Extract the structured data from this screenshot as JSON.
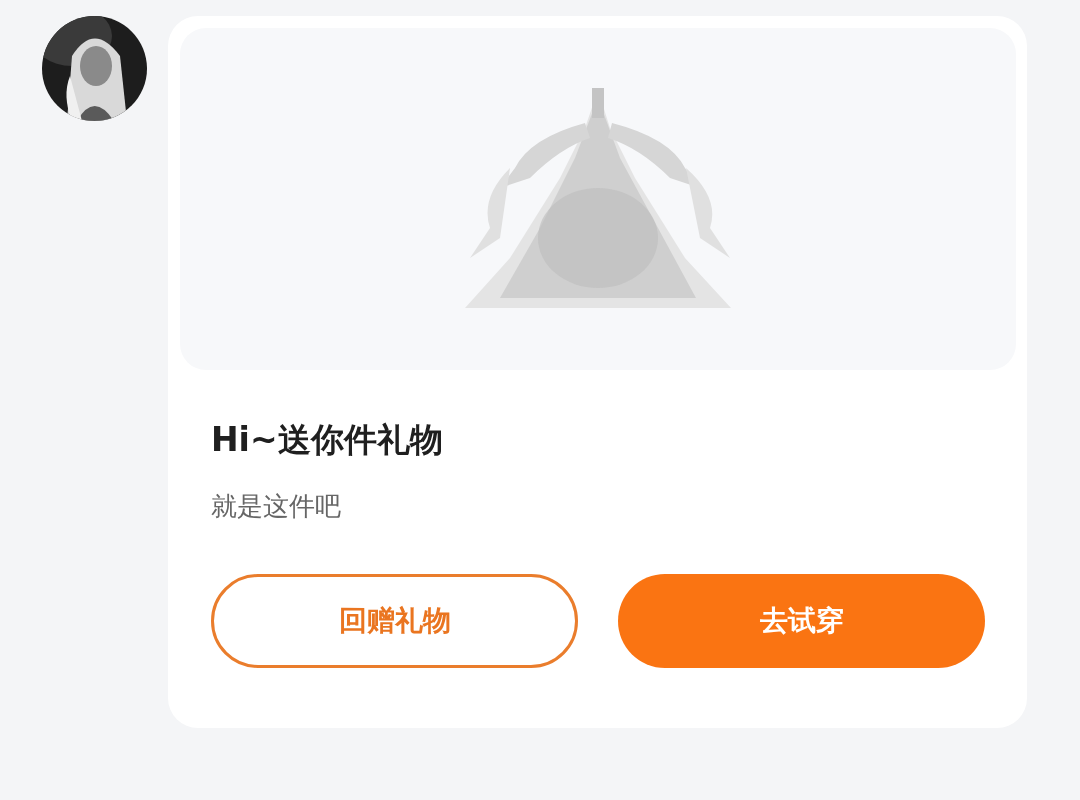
{
  "message": {
    "title": "Hi~送你件礼物",
    "subtitle": "就是这件吧",
    "buttons": [
      {
        "label": "回赠礼物",
        "kind": "outline"
      },
      {
        "label": "去试穿",
        "kind": "filled"
      }
    ]
  }
}
